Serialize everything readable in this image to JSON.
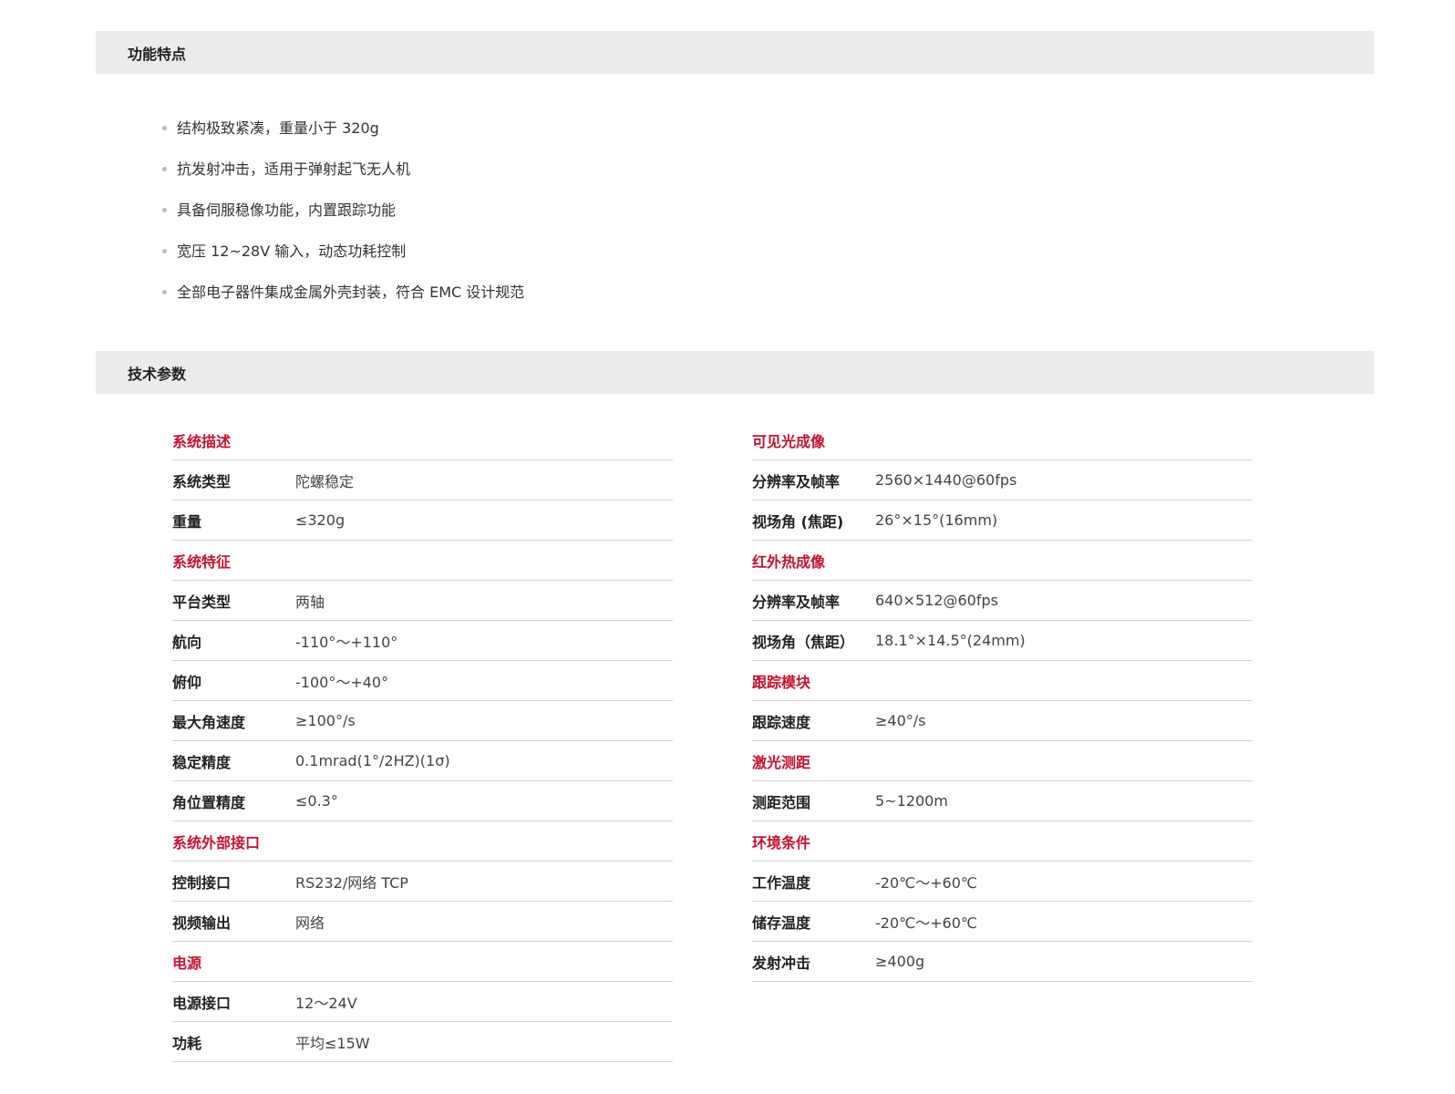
{
  "features_section": {
    "title": "功能特点",
    "items": [
      "结构极致紧凑，重量小于 320g",
      "抗发射冲击，适用于弹射起飞无人机",
      "具备伺服稳像功能，内置跟踪功能",
      "宽压 12~28V 输入，动态功耗控制",
      "全部电子器件集成金属外壳封装，符合 EMC 设计规范"
    ]
  },
  "specs_section": {
    "title": "技术参数",
    "left": [
      {
        "type": "head",
        "label": "系统描述"
      },
      {
        "type": "row",
        "label": "系统类型",
        "value": "陀螺稳定"
      },
      {
        "type": "row",
        "label": "重量",
        "value": "≤320g"
      },
      {
        "type": "head",
        "label": "系统特征"
      },
      {
        "type": "row",
        "label": "平台类型",
        "value": "两轴"
      },
      {
        "type": "row",
        "label": "航向",
        "value": "-110°～+110°"
      },
      {
        "type": "row",
        "label": "俯仰",
        "value": "-100°～+40°"
      },
      {
        "type": "row",
        "label": "最大角速度",
        "value": "≥100°/s"
      },
      {
        "type": "row",
        "label": "稳定精度",
        "value": "0.1mrad(1°/2HZ)(1σ)"
      },
      {
        "type": "row",
        "label": "角位置精度",
        "value": "≤0.3°"
      },
      {
        "type": "head",
        "label": "系统外部接口"
      },
      {
        "type": "row",
        "label": "控制接口",
        "value": "RS232/网络 TCP"
      },
      {
        "type": "row",
        "label": "视频输出",
        "value": "网络"
      },
      {
        "type": "head",
        "label": "电源"
      },
      {
        "type": "row",
        "label": "电源接口",
        "value": "12～24V"
      },
      {
        "type": "row",
        "label": "功耗",
        "value": "平均≤15W"
      }
    ],
    "right": [
      {
        "type": "head",
        "label": "可见光成像"
      },
      {
        "type": "row",
        "label": "分辨率及帧率",
        "value": "2560×1440@60fps"
      },
      {
        "type": "row",
        "label": "视场角 (焦距)",
        "value": "26°×15°(16mm)"
      },
      {
        "type": "head",
        "label": "红外热成像"
      },
      {
        "type": "row",
        "label": "分辨率及帧率",
        "value": "640×512@60fps"
      },
      {
        "type": "row",
        "label": "视场角（焦距）",
        "value": "18.1°×14.5°(24mm)"
      },
      {
        "type": "head",
        "label": "跟踪模块"
      },
      {
        "type": "row",
        "label": "跟踪速度",
        "value": "≥40°/s"
      },
      {
        "type": "head",
        "label": "激光测距"
      },
      {
        "type": "row",
        "label": "测距范围",
        "value": "5~1200m"
      },
      {
        "type": "head",
        "label": "环境条件"
      },
      {
        "type": "row",
        "label": "工作温度",
        "value": "-20℃～+60℃"
      },
      {
        "type": "row",
        "label": "储存温度",
        "value": "-20℃～+60℃"
      },
      {
        "type": "row",
        "label": "发射冲击",
        "value": "≥400g"
      }
    ]
  },
  "colors": {
    "accent": "#c8102e",
    "bar_bg": "#ebebeb",
    "divider": "#d4d4d4"
  }
}
